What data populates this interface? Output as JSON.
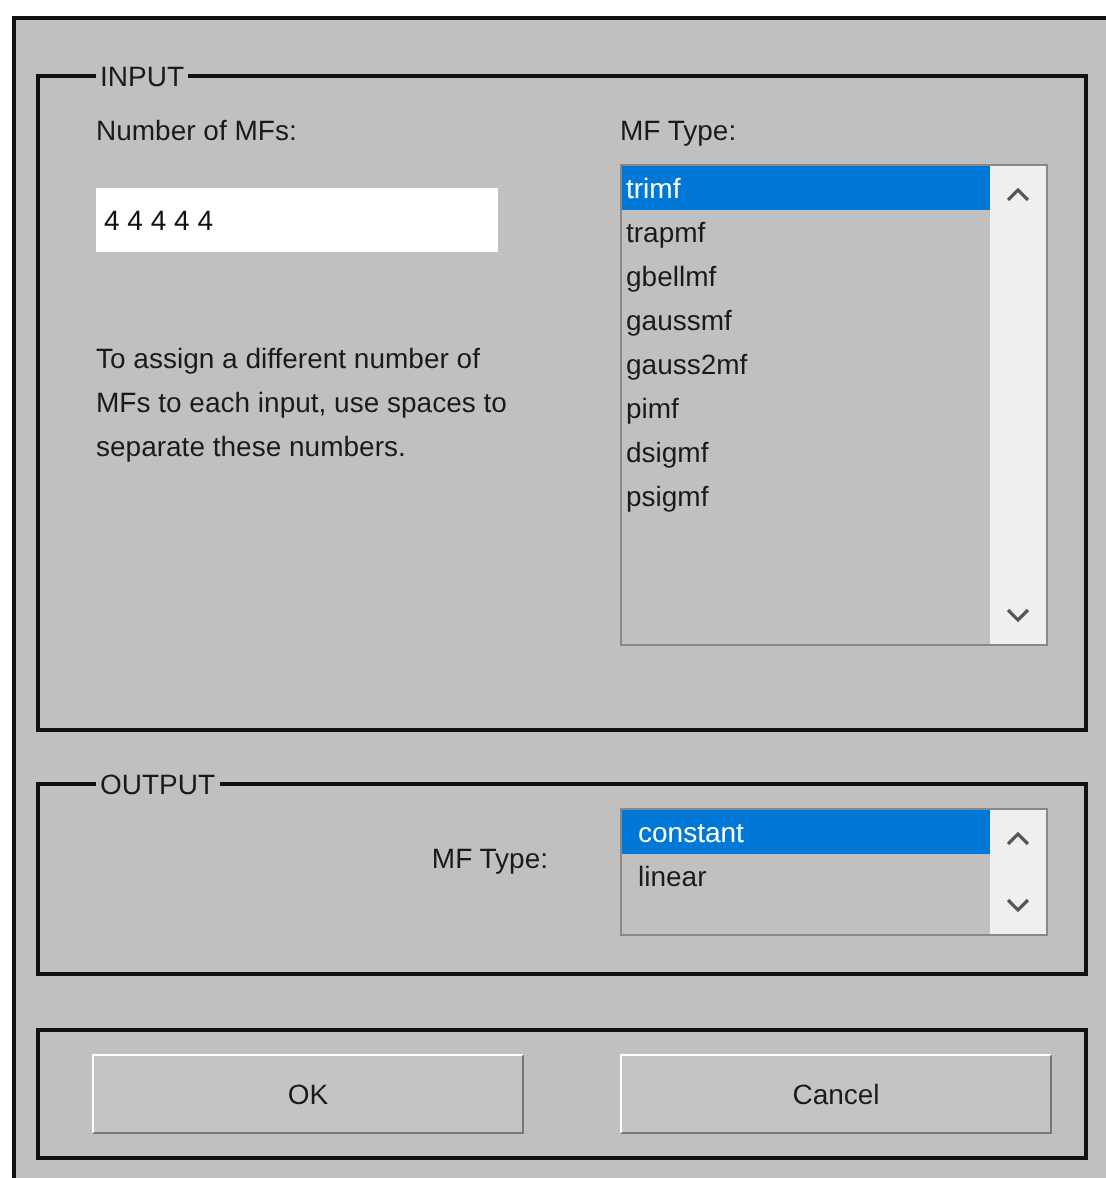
{
  "input": {
    "title": "INPUT",
    "count_label": "Number of MFs:",
    "count_value": "4 4 4 4 4",
    "help": "To assign a different number of MFs to each input, use spaces to separate these numbers.",
    "type_label": "MF Type:",
    "types": [
      {
        "label": "trimf",
        "selected": true
      },
      {
        "label": "trapmf",
        "selected": false
      },
      {
        "label": "gbellmf",
        "selected": false
      },
      {
        "label": "gaussmf",
        "selected": false
      },
      {
        "label": "gauss2mf",
        "selected": false
      },
      {
        "label": "pimf",
        "selected": false
      },
      {
        "label": "dsigmf",
        "selected": false
      },
      {
        "label": "psigmf",
        "selected": false
      }
    ]
  },
  "output": {
    "title": "OUTPUT",
    "type_label": "MF Type:",
    "types": [
      {
        "label": "constant",
        "selected": true
      },
      {
        "label": "linear",
        "selected": false
      }
    ]
  },
  "buttons": [
    "OK",
    "Cancel"
  ]
}
